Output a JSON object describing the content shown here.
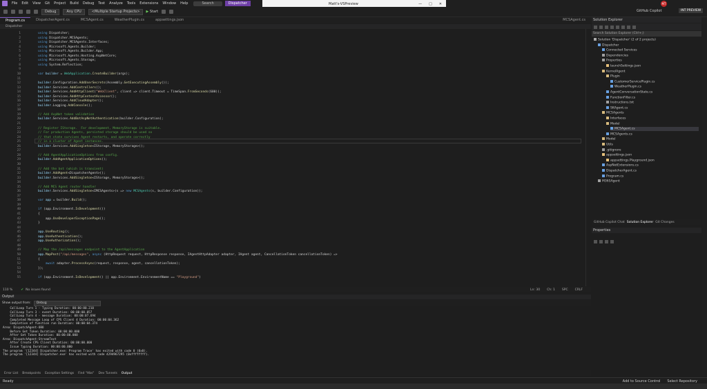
{
  "menu": {
    "items": [
      "File",
      "Edit",
      "View",
      "Git",
      "Project",
      "Build",
      "Debug",
      "Test",
      "Analyze",
      "Tools",
      "Extensions",
      "Window",
      "Help"
    ],
    "search": "Search",
    "solution": "Dispatcher"
  },
  "window": {
    "title": "Matt's-VSPreview"
  },
  "toolbar": {
    "config": "Debug",
    "platform": "Any CPU",
    "startup": "<Multiple Startup Projects>",
    "start": "Start"
  },
  "account": {
    "initials": "MT",
    "copilot": "GitHub Copilot",
    "preview": "INT PREVIEW"
  },
  "tabs": [
    "Program.cs",
    "DispatcherAgent.cs",
    "MCSAgent.cs",
    "WeatherPlugin.cs",
    "appsettings.json"
  ],
  "tab_right": "MCSAgent.cs",
  "breadcrumb": "Dispatcher",
  "code_lines": [
    {
      "n": "1",
      "parts": [
        [
          "kw",
          "using "
        ],
        [
          "pl",
          "Dispatcher;"
        ]
      ]
    },
    {
      "n": "2",
      "parts": [
        [
          "kw",
          "using "
        ],
        [
          "pl",
          "Dispatcher.MCSAgents;"
        ]
      ]
    },
    {
      "n": "3",
      "parts": [
        [
          "kw",
          "using "
        ],
        [
          "pl",
          "Dispatcher.MCSAgents.Interfaces;"
        ]
      ]
    },
    {
      "n": "4",
      "parts": [
        [
          "kw",
          "using "
        ],
        [
          "pl",
          "Microsoft.Agents.Builder;"
        ]
      ]
    },
    {
      "n": "5",
      "parts": [
        [
          "kw",
          "using "
        ],
        [
          "pl",
          "Microsoft.Agents.Builder.App;"
        ]
      ]
    },
    {
      "n": "6",
      "parts": [
        [
          "kw",
          "using "
        ],
        [
          "pl",
          "Microsoft.Agents.Hosting.AspNetCore;"
        ]
      ]
    },
    {
      "n": "7",
      "parts": [
        [
          "kw",
          "using "
        ],
        [
          "pl",
          "Microsoft.Agents.Storage;"
        ]
      ]
    },
    {
      "n": "8",
      "parts": [
        [
          "kw",
          "using "
        ],
        [
          "pl",
          "System.Reflection;"
        ]
      ]
    },
    {
      "n": "9",
      "parts": []
    },
    {
      "n": "10",
      "parts": [
        [
          "kw",
          "var "
        ],
        [
          "id",
          "builder"
        ],
        [
          "pl",
          " = "
        ],
        [
          "ty",
          "WebApplication"
        ],
        [
          "pl",
          "."
        ],
        [
          "fn",
          "CreateBuilder"
        ],
        [
          "pl",
          "(args);"
        ]
      ]
    },
    {
      "n": "11",
      "parts": []
    },
    {
      "n": "12",
      "parts": [
        [
          "id",
          "builder"
        ],
        [
          "pl",
          ".Configuration."
        ],
        [
          "fn",
          "AddUserSecrets"
        ],
        [
          "pl",
          "(Assembly."
        ],
        [
          "fn",
          "GetExecutingAssembly"
        ],
        [
          "pl",
          "());"
        ]
      ]
    },
    {
      "n": "13",
      "parts": [
        [
          "id",
          "builder"
        ],
        [
          "pl",
          ".Services."
        ],
        [
          "fn",
          "AddControllers"
        ],
        [
          "pl",
          "();"
        ]
      ]
    },
    {
      "n": "14",
      "parts": [
        [
          "id",
          "builder"
        ],
        [
          "pl",
          ".Services."
        ],
        [
          "fn",
          "AddHttpClient"
        ],
        [
          "pl",
          "("
        ],
        [
          "str",
          "\"WebClient\""
        ],
        [
          "pl",
          ", client => client.Timeout = TimeSpan."
        ],
        [
          "fn",
          "FromSeconds"
        ],
        [
          "pl",
          "(600));"
        ]
      ]
    },
    {
      "n": "15",
      "parts": [
        [
          "id",
          "builder"
        ],
        [
          "pl",
          ".Services."
        ],
        [
          "fn",
          "AddHttpContextAccessor"
        ],
        [
          "pl",
          "();"
        ]
      ]
    },
    {
      "n": "16",
      "parts": [
        [
          "id",
          "builder"
        ],
        [
          "pl",
          ".Services."
        ],
        [
          "fn",
          "AddCloudAdapter"
        ],
        [
          "pl",
          "();"
        ]
      ]
    },
    {
      "n": "17",
      "parts": [
        [
          "id",
          "builder"
        ],
        [
          "pl",
          ".Logging."
        ],
        [
          "fn",
          "AddConsole"
        ],
        [
          "pl",
          "();"
        ]
      ]
    },
    {
      "n": "18",
      "parts": []
    },
    {
      "n": "19",
      "parts": [
        [
          "cm",
          "// Add AspNet token validation"
        ]
      ]
    },
    {
      "n": "20",
      "parts": [
        [
          "id",
          "builder"
        ],
        [
          "pl",
          ".Services."
        ],
        [
          "fn",
          "AddBotAspNetAuthentication"
        ],
        [
          "pl",
          "(builder.Configuration);"
        ]
      ]
    },
    {
      "n": "21",
      "parts": []
    },
    {
      "n": "22",
      "parts": [
        [
          "cm",
          "// Register IStorage.  For development, MemoryStorage is suitable."
        ]
      ]
    },
    {
      "n": "23",
      "parts": [
        [
          "cm",
          "// For production Agents, persisted storage should be used so"
        ]
      ]
    },
    {
      "n": "24",
      "parts": [
        [
          "cm",
          "// that state survives Agent restarts, and operate correctly"
        ]
      ]
    },
    {
      "n": "25",
      "parts": [
        [
          "cm",
          "// in a cluster of Agent instances."
        ]
      ]
    },
    {
      "n": "26",
      "parts": [
        [
          "id",
          "builder"
        ],
        [
          "pl",
          ".Services."
        ],
        [
          "fn",
          "AddSingleton"
        ],
        [
          "pl",
          "<IStorage, MemoryStorage>();"
        ]
      ]
    },
    {
      "n": "27",
      "parts": []
    },
    {
      "n": "28",
      "parts": [
        [
          "cm",
          "// Add AgentApplicationOptions from config."
        ]
      ]
    },
    {
      "n": "29",
      "parts": [
        [
          "id",
          "builder"
        ],
        [
          "pl",
          "."
        ],
        [
          "fn",
          "AddAgentApplicationOptions"
        ],
        [
          "pl",
          "();"
        ]
      ]
    },
    {
      "n": "30",
      "parts": []
    },
    {
      "n": "31",
      "parts": [
        [
          "cm",
          "// Add the bot (which is transient)"
        ]
      ]
    },
    {
      "n": "32",
      "parts": [
        [
          "id",
          "builder"
        ],
        [
          "pl",
          "."
        ],
        [
          "fn",
          "AddAgent"
        ],
        [
          "pl",
          "<DispatcherAgent>();"
        ]
      ]
    },
    {
      "n": "33",
      "parts": [
        [
          "id",
          "builder"
        ],
        [
          "pl",
          ".Services."
        ],
        [
          "fn",
          "AddSingleton"
        ],
        [
          "pl",
          "<IStorage, MemoryStorage>();"
        ]
      ]
    },
    {
      "n": "34",
      "parts": []
    },
    {
      "n": "35",
      "parts": [
        [
          "cm",
          "// Add MCS Agent router handler"
        ]
      ]
    },
    {
      "n": "36",
      "parts": [
        [
          "id",
          "builder"
        ],
        [
          "pl",
          ".Services."
        ],
        [
          "fn",
          "AddSingleton"
        ],
        [
          "pl",
          "<IMCSAgents>(s => "
        ],
        [
          "kw",
          "new "
        ],
        [
          "ty",
          "MCSAgents"
        ],
        [
          "pl",
          "(s, builder.Configuration));"
        ]
      ]
    },
    {
      "n": "37",
      "parts": []
    },
    {
      "n": "38",
      "parts": [
        [
          "kw",
          "var "
        ],
        [
          "id",
          "app"
        ],
        [
          "pl",
          " = builder."
        ],
        [
          "fn",
          "Build"
        ],
        [
          "pl",
          "();"
        ]
      ]
    },
    {
      "n": "39",
      "parts": []
    },
    {
      "n": "40",
      "parts": [
        [
          "kw",
          "if "
        ],
        [
          "pl",
          "(app.Environment."
        ],
        [
          "fn",
          "IsDevelopment"
        ],
        [
          "pl",
          "())"
        ]
      ]
    },
    {
      "n": "41",
      "parts": [
        [
          "pl",
          "{"
        ]
      ]
    },
    {
      "n": "42",
      "parts": [
        [
          "pl",
          "    app."
        ],
        [
          "fn",
          "UseDeveloperExceptionPage"
        ],
        [
          "pl",
          "();"
        ]
      ]
    },
    {
      "n": "43",
      "parts": [
        [
          "pl",
          "}"
        ]
      ]
    },
    {
      "n": "44",
      "parts": []
    },
    {
      "n": "45",
      "parts": [
        [
          "id",
          "app"
        ],
        [
          "pl",
          "."
        ],
        [
          "fn",
          "UseRouting"
        ],
        [
          "pl",
          "();"
        ]
      ]
    },
    {
      "n": "46",
      "parts": [
        [
          "id",
          "app"
        ],
        [
          "pl",
          "."
        ],
        [
          "fn",
          "UseAuthentication"
        ],
        [
          "pl",
          "();"
        ]
      ]
    },
    {
      "n": "47",
      "parts": [
        [
          "id",
          "app"
        ],
        [
          "pl",
          "."
        ],
        [
          "fn",
          "UseAuthorization"
        ],
        [
          "pl",
          "();"
        ]
      ]
    },
    {
      "n": "48",
      "parts": []
    },
    {
      "n": "49",
      "parts": [
        [
          "cm",
          "// Map the /api/messages endpoint to the AgentApplication"
        ]
      ]
    },
    {
      "n": "50",
      "parts": [
        [
          "id",
          "app"
        ],
        [
          "pl",
          "."
        ],
        [
          "fn",
          "MapPost"
        ],
        [
          "pl",
          "("
        ],
        [
          "str",
          "\"/api/messages\""
        ],
        [
          "pl",
          ", "
        ],
        [
          "kw",
          "async "
        ],
        [
          "pl",
          "(HttpRequest request, HttpResponse response, IAgentHttpAdapter adapter, IAgent agent, CancellationToken cancellationToken) =>"
        ]
      ]
    },
    {
      "n": "51",
      "parts": [
        [
          "pl",
          "{"
        ]
      ]
    },
    {
      "n": "52",
      "parts": [
        [
          "pl",
          "    "
        ],
        [
          "kw",
          "await "
        ],
        [
          "pl",
          "adapter."
        ],
        [
          "fn",
          "ProcessAsync"
        ],
        [
          "pl",
          "(request, response, agent, cancellationToken);"
        ]
      ]
    },
    {
      "n": "53",
      "parts": [
        [
          "pl",
          "});"
        ]
      ]
    },
    {
      "n": "54",
      "parts": []
    },
    {
      "n": "55",
      "parts": [
        [
          "kw",
          "if "
        ],
        [
          "pl",
          "(app.Environment."
        ],
        [
          "fn",
          "IsDevelopment"
        ],
        [
          "pl",
          "() || app.Environment.EnvironmentName == "
        ],
        [
          "str",
          "\"Playground\""
        ],
        [
          "pl",
          ")"
        ]
      ]
    }
  ],
  "editor_status": {
    "zoom": "110 %",
    "issues": "No issues found",
    "ln": "Ln: 30",
    "ch": "Ch: 1",
    "spc": "SPC",
    "crlf": "CRLF"
  },
  "output": {
    "title": "Output",
    "show_from_label": "Show output from:",
    "show_from_value": "Debug",
    "lines": [
      "    CallLoop Turn 1 - Typing Duration: 00:00:00.210",
      "    CallLoop Turn 3 - event Duration: 00:00:00.057",
      "    CallLoop Turn 4 - message Duration: 00:00:07.694",
      "    Completed Message Loop of CPS Client 4 Duration: 00:00:04.362",
      "    Completion of function run Duration: 00:00:04.374",
      "Area: DispatchAgent-OBO",
      "    Before Get Token Duration: 00:00:00.000",
      "    After Get Token Duration: 00:00:00.000",
      "Area: DispatchAgent-StreamText",
      "    After Create CPS Client Duration: 00:00:00.000",
      "    Issue Typing Duration: 00:00:00.000",
      "The program '[12344] Dispatcher.exe: Program Trace' has exited with code 0 (0x0).",
      "The program '[12344] Dispatcher.exe' has exited with code 4294967295 (0xffffffff)."
    ]
  },
  "bottom_tabs": [
    "Error List",
    "Breakpoints",
    "Exception Settings",
    "Find \"Hbs\"",
    "Dev Tunnels",
    "Output"
  ],
  "status": {
    "ready": "Ready",
    "source_control": "Add to Source Control",
    "repo": "Select Repository"
  },
  "solution_explorer": {
    "title": "Solution Explorer",
    "search": "Search Solution Explorer (Ctrl+;)",
    "tree": [
      {
        "d": 0,
        "t": "Solution 'Dispatcher' (2 of 2 projects)",
        "c": "#aaaaaa"
      },
      {
        "d": 1,
        "t": "Dispatcher",
        "c": "#68a0e0"
      },
      {
        "d": 2,
        "t": "Connected Services",
        "c": "#68a0e0"
      },
      {
        "d": 2,
        "t": "Dependencies",
        "c": "#a0a0a0"
      },
      {
        "d": 2,
        "t": "Properties",
        "c": "#a0a0a0"
      },
      {
        "d": 3,
        "t": "launchSettings.json",
        "c": "#e5c07b"
      },
      {
        "d": 2,
        "t": "KernelAgent",
        "c": "#d7ba7d"
      },
      {
        "d": 3,
        "t": "Plugin",
        "c": "#d7ba7d"
      },
      {
        "d": 4,
        "t": "CustomerServicePlugin.cs",
        "c": "#68a0e0"
      },
      {
        "d": 4,
        "t": "WeatherPlugin.cs",
        "c": "#68a0e0"
      },
      {
        "d": 3,
        "t": "AgentConversationState.cs",
        "c": "#68a0e0"
      },
      {
        "d": 3,
        "t": "FunctionFilter.cs",
        "c": "#68a0e0"
      },
      {
        "d": 3,
        "t": "Instructions.txt",
        "c": "#a0a0a0"
      },
      {
        "d": 3,
        "t": "SKAgent.cs",
        "c": "#68a0e0"
      },
      {
        "d": 2,
        "t": "MCSAgents",
        "c": "#d7ba7d"
      },
      {
        "d": 3,
        "t": "Interfaces",
        "c": "#d7ba7d"
      },
      {
        "d": 3,
        "t": "Model",
        "c": "#d7ba7d"
      },
      {
        "d": 4,
        "t": "MCSAgent.cs",
        "c": "#68a0e0",
        "sel": true
      },
      {
        "d": 3,
        "t": "MCSAgents.cs",
        "c": "#68a0e0"
      },
      {
        "d": 2,
        "t": "Model",
        "c": "#d7ba7d"
      },
      {
        "d": 2,
        "t": "Utils",
        "c": "#d7ba7d"
      },
      {
        "d": 2,
        "t": ".gitignore",
        "c": "#a0a0a0"
      },
      {
        "d": 2,
        "t": "appsettings.json",
        "c": "#e5c07b"
      },
      {
        "d": 3,
        "t": "appsettings.Playground.json",
        "c": "#e5c07b"
      },
      {
        "d": 2,
        "t": "AspNetExtensions.cs",
        "c": "#68a0e0"
      },
      {
        "d": 2,
        "t": "DispatcherAgent.cs",
        "c": "#68a0e0"
      },
      {
        "d": 2,
        "t": "Program.cs",
        "c": "#68a0e0"
      },
      {
        "d": 1,
        "t": "M365Agent",
        "c": "#a0a0a0"
      }
    ],
    "tabs": [
      "GitHub Copilot Chat",
      "Solution Explorer",
      "Git Changes"
    ]
  },
  "properties": {
    "title": "Properties"
  }
}
